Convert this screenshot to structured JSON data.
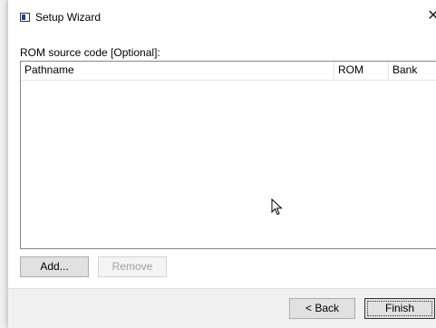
{
  "window": {
    "title": "Setup Wizard",
    "close_glyph": "✕"
  },
  "section": {
    "label": "ROM source code [Optional]:"
  },
  "listview": {
    "columns": [
      "Pathname",
      "ROM",
      "Bank"
    ],
    "rows": []
  },
  "buttons": {
    "add": "Add...",
    "remove": "Remove",
    "back": "< Back",
    "finish": "Finish"
  },
  "icons": {
    "app": "app-window-icon",
    "close": "close-icon",
    "cursor": "mouse-pointer-icon"
  }
}
